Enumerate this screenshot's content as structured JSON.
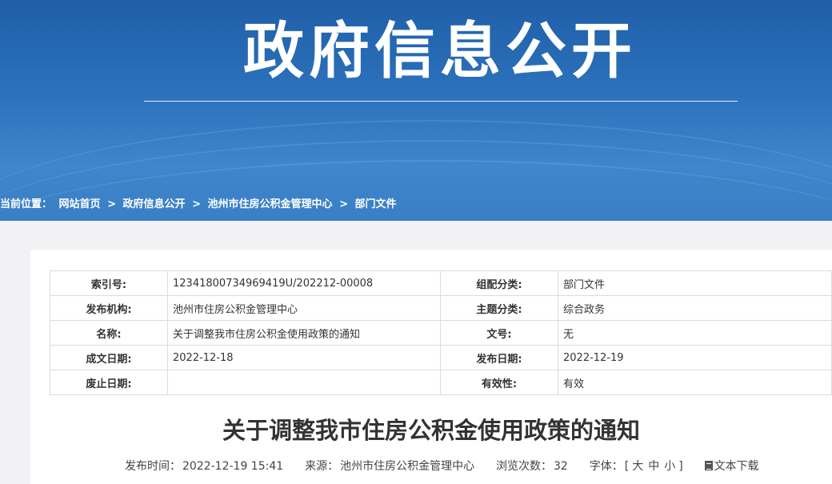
{
  "banner": {
    "title": "政府信息公开"
  },
  "breadcrumb": {
    "prefix": "当前位置：",
    "separator": ">",
    "items": [
      "网站首页",
      "政府信息公开",
      "池州市住房公积金管理中心",
      "部门文件"
    ]
  },
  "meta": {
    "rows": [
      {
        "k1": "索引号:",
        "v1": "12341800734969419U/202212-00008",
        "k2": "组配分类:",
        "v2": "部门文件"
      },
      {
        "k1": "发布机构:",
        "v1": "池州市住房公积金管理中心",
        "k2": "主题分类:",
        "v2": "综合政务"
      },
      {
        "k1": "名称:",
        "v1": "关于调整我市住房公积金使用政策的通知",
        "k2": "文号:",
        "v2": "无"
      },
      {
        "k1": "成文日期:",
        "v1": "2022-12-18",
        "k2": "发布日期:",
        "v2": "2022-12-19"
      },
      {
        "k1": "废止日期:",
        "v1": "",
        "k2": "有效性:",
        "v2": "有效"
      }
    ]
  },
  "article": {
    "title": "关于调整我市住房公积金使用政策的通知"
  },
  "info": {
    "publish_label": "发布时间：",
    "publish_time": "2022-12-19 15:41",
    "source_label": "来源：",
    "source": "池州市住房公积金管理中心",
    "views_label": "浏览次数：",
    "views": "32",
    "font_label": "字体：",
    "font_open": "[",
    "font_large": "大",
    "font_medium": "中",
    "font_small": "小",
    "font_close": "]",
    "download": "文本下载"
  },
  "colors": {
    "banner": "#2d73bd",
    "text": "#333333"
  }
}
